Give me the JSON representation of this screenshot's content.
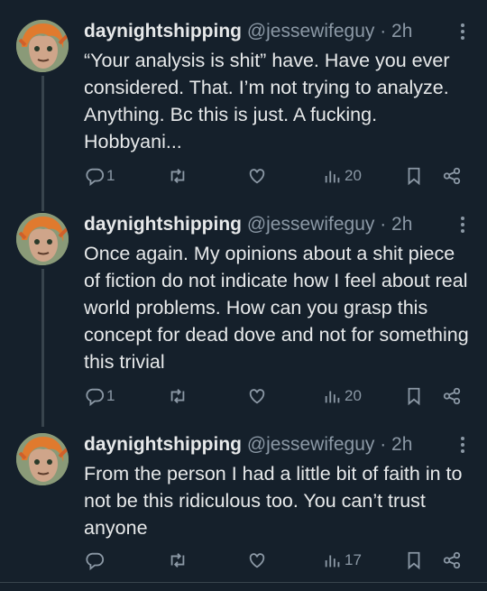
{
  "tweets": [
    {
      "display_name": "daynightshipping",
      "handle": "@jessewifeguy",
      "time": "· 2h",
      "text": "“Your analysis is shit” have. Have you ever considered. That. I’m not trying to analyze. Anything. Bc this is just. A fucking. Hobbyani...",
      "replies": "1",
      "retweets": "",
      "likes": "",
      "views": "20"
    },
    {
      "display_name": "daynightshipping",
      "handle": "@jessewifeguy",
      "time": "· 2h",
      "text": "Once again. My opinions about a shit piece of fiction do not indicate how I feel about real world problems. How can you grasp this concept for dead dove and not for something this trivial",
      "replies": "1",
      "retweets": "",
      "likes": "",
      "views": "20"
    },
    {
      "display_name": "daynightshipping",
      "handle": "@jessewifeguy",
      "time": "· 2h",
      "text": "From the person I had a little bit of faith in to not be this ridiculous too. You can’t trust anyone",
      "replies": "",
      "retweets": "",
      "likes": "",
      "views": "17"
    }
  ],
  "icons": {
    "reply": "reply-icon",
    "retweet": "retweet-icon",
    "like": "heart-icon",
    "views": "views-icon",
    "bookmark": "bookmark-icon",
    "share": "share-icon",
    "more": "more-icon"
  },
  "colors": {
    "background": "#15202b",
    "text": "#e7e9ea",
    "muted": "#8b98a5",
    "divider": "#38444d"
  }
}
